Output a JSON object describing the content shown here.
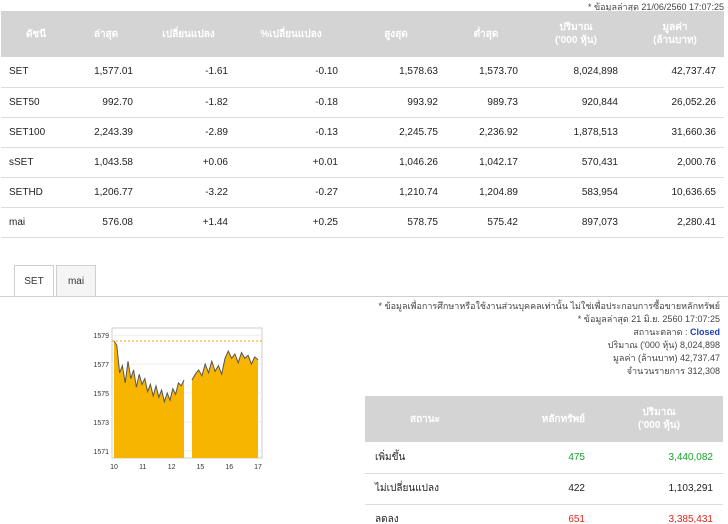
{
  "last_update_top": "* ข้อมูลล่าสุด 21/06/2560 17:07:25",
  "index_table": {
    "headers": [
      "ดัชนี",
      "ล่าสุด",
      "เปลี่ยนแปลง",
      "%เปลี่ยนแปลง",
      "สูงสุด",
      "ต่ำสุด",
      "ปริมาณ\n('000 หุ้น)",
      "มูลค่า\n(ล้านบาท)"
    ],
    "rows": [
      {
        "name": "SET",
        "last": "1,577.01",
        "chg": "-1.61",
        "pct": "-0.10",
        "high": "1,578.63",
        "low": "1,573.70",
        "vol": "8,024,898",
        "val": "42,737.47"
      },
      {
        "name": "SET50",
        "last": "992.70",
        "chg": "-1.82",
        "pct": "-0.18",
        "high": "993.92",
        "low": "989.73",
        "vol": "920,844",
        "val": "26,052.26"
      },
      {
        "name": "SET100",
        "last": "2,243.39",
        "chg": "-2.89",
        "pct": "-0.13",
        "high": "2,245.75",
        "low": "2,236.92",
        "vol": "1,878,513",
        "val": "31,660.36"
      },
      {
        "name": "sSET",
        "last": "1,043.58",
        "chg": "+0.06",
        "pct": "+0.01",
        "high": "1,046.26",
        "low": "1,042.17",
        "vol": "570,431",
        "val": "2,000.76"
      },
      {
        "name": "SETHD",
        "last": "1,206.77",
        "chg": "-3.22",
        "pct": "-0.27",
        "high": "1,210.74",
        "low": "1,204.89",
        "vol": "583,954",
        "val": "10,636.65"
      },
      {
        "name": "mai",
        "last": "576.08",
        "chg": "+1.44",
        "pct": "+0.25",
        "high": "578.75",
        "low": "575.42",
        "vol": "897,073",
        "val": "2,280.41"
      }
    ]
  },
  "tabs": [
    "SET",
    "mai"
  ],
  "info": {
    "disclaimer": "* ข้อมูลเพื่อการศึกษาหรือใช้งานส่วนบุคคลเท่านั้น ไม่ใช่เพื่อประกอบการซื้อขายหลักทรัพย์",
    "last_update": "* ข้อมูลล่าสุด 21 มิ.ย. 2560 17:07:25",
    "market_status_label": "สถานะตลาด :",
    "market_status_value": "Closed",
    "volume_label": "ปริมาณ ('000 หุ้น)",
    "volume_value": "8,024,898",
    "value_label": "มูลค่า (ล้านบาท)",
    "value_value": "42,737.47",
    "trades_label": "จำนวนรายการ",
    "trades_value": "312,308"
  },
  "status_table": {
    "headers": [
      "สถานะ",
      "หลักทรัพย์",
      "ปริมาณ\n('000 หุ้น)"
    ],
    "rows": [
      {
        "label": "เพิ่มขึ้น",
        "count": "475",
        "vol": "3,440,082",
        "color": "#13a027"
      },
      {
        "label": "ไม่เปลี่ยนแปลง",
        "count": "422",
        "vol": "1,103,291",
        "color": "#222222"
      },
      {
        "label": "ลดลง",
        "count": "651",
        "vol": "3,385,431",
        "color": "#e2231a"
      }
    ]
  },
  "colors": {
    "fill": "#f7b500",
    "line": "#555555",
    "ref_line": "#f0a000"
  },
  "chart_data": {
    "type": "area",
    "title": "",
    "xlabel": "",
    "ylabel": "",
    "x_ticks": [
      "10",
      "11",
      "12",
      "15",
      "16",
      "17"
    ],
    "y_ticks": [
      "1579",
      "1577",
      "1575",
      "1573",
      "1571"
    ],
    "ylim": [
      1570.5,
      1579.5
    ],
    "reference_value": 1578.6,
    "series": [
      {
        "values": [
          1578.6,
          1578.3,
          1576.4,
          1576.9,
          1575.7,
          1577.2,
          1576.0,
          1576.6,
          1575.4,
          1576.3,
          1575.6,
          1576.0,
          1575.1,
          1575.6,
          1574.8,
          1575.5,
          1574.7,
          1575.2,
          1574.4,
          1575.0,
          1574.5,
          1575.3,
          1574.9,
          1575.7,
          1575.5,
          1575.9
        ]
      },
      {
        "values": [
          1575.9,
          1576.3,
          1576.6,
          1576.2,
          1577.0,
          1576.4,
          1577.2,
          1576.5,
          1576.9,
          1576.3,
          1577.4,
          1577.9,
          1577.4,
          1577.7,
          1577.1,
          1577.8,
          1577.4,
          1577.6,
          1577.0,
          1577.5,
          1577.3
        ]
      }
    ]
  }
}
